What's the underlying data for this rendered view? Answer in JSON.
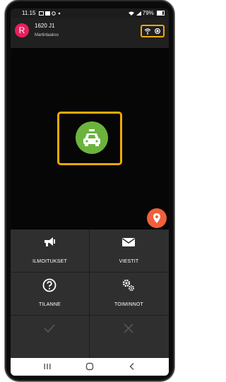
{
  "status_bar": {
    "time": "11.15",
    "icons_left": [
      "image-icon",
      "message-icon",
      "circle-icon",
      "dot-icon"
    ],
    "icons_right": [
      "wifi-icon",
      "signal-icon"
    ],
    "battery": "79%"
  },
  "header": {
    "avatar_letter": "R",
    "title": "1620 J1",
    "subtitle": "Martinlaakso",
    "icons": [
      "wifi-broadcast-icon",
      "gps-target-icon"
    ],
    "highlight_color": "#f2a900"
  },
  "map": {
    "taxi_button_icon": "taxi-car-icon",
    "taxi_button_color": "#6cb33e",
    "location_fab_icon": "location-pin-icon",
    "location_fab_color": "#f0603a"
  },
  "actions": [
    {
      "label": "ILMOITUKSET",
      "icon": "megaphone-icon"
    },
    {
      "label": "VIESTIT",
      "icon": "envelope-icon"
    },
    {
      "label": "TILANNE",
      "icon": "help-circle-icon"
    },
    {
      "label": "TOIMINNOT",
      "icon": "gears-icon"
    },
    {
      "label": "",
      "icon": "check-icon",
      "disabled": true
    },
    {
      "label": "",
      "icon": "close-icon",
      "disabled": true
    }
  ],
  "nav_bar": {
    "buttons": [
      "recent-apps-icon",
      "home-icon",
      "back-icon"
    ]
  }
}
